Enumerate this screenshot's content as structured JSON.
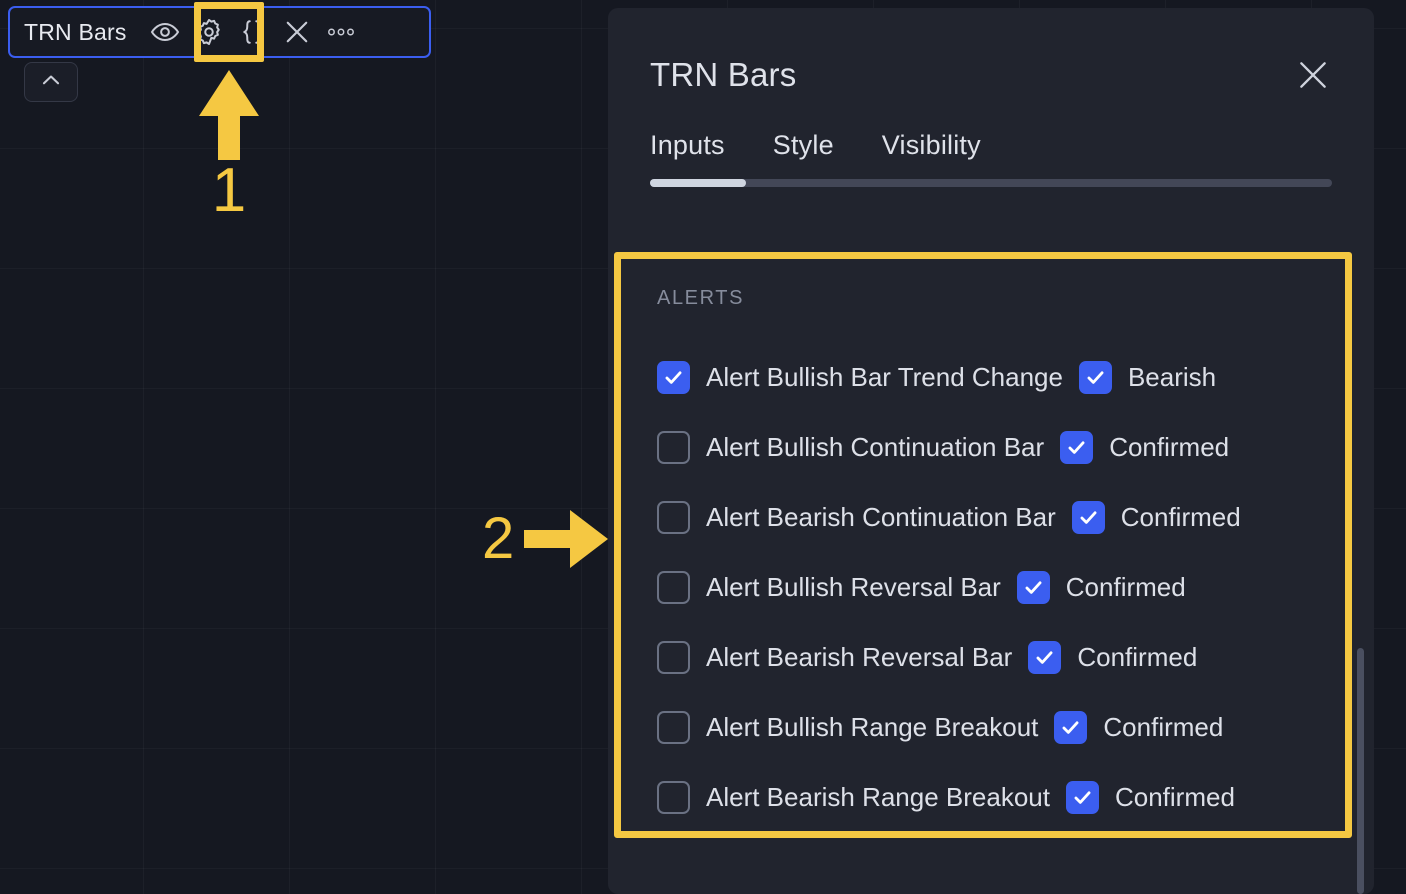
{
  "chart": {
    "background_color": "#151821",
    "grid": true
  },
  "indicator_toolbar": {
    "title": "TRN Bars",
    "border_color": "#3b5ef0",
    "icons": [
      {
        "name": "eye-icon",
        "label": "Hide / show indicator"
      },
      {
        "name": "gear-icon",
        "label": "Settings"
      },
      {
        "name": "braces-icon",
        "label": "Source code"
      },
      {
        "name": "close-icon",
        "label": "Remove indicator"
      },
      {
        "name": "more-icon",
        "label": "More"
      }
    ],
    "collapse_button": {
      "name": "chevron-up-icon",
      "label": "Collapse pane"
    }
  },
  "annotations": {
    "highlight_color": "#f5c842",
    "marker_one": {
      "number": "1",
      "direction": "up",
      "target": "gear-icon"
    },
    "marker_two": {
      "number": "2",
      "direction": "right",
      "target": "alerts-section"
    }
  },
  "dialog": {
    "title": "TRN Bars",
    "close_label": "×",
    "background_color": "#21242e",
    "tabs": [
      {
        "label": "Inputs",
        "active": true
      },
      {
        "label": "Style",
        "active": false
      },
      {
        "label": "Visibility",
        "active": false
      }
    ],
    "section": {
      "label": "ALERTS",
      "rows": [
        {
          "checked": true,
          "label": "Alert Bullish Bar Trend Change",
          "sub_checked": true,
          "sub_label": "Bearish"
        },
        {
          "checked": false,
          "label": "Alert Bullish Continuation Bar",
          "sub_checked": true,
          "sub_label": "Confirmed"
        },
        {
          "checked": false,
          "label": "Alert Bearish Continuation Bar",
          "sub_checked": true,
          "sub_label": "Confirmed"
        },
        {
          "checked": false,
          "label": "Alert Bullish Reversal Bar",
          "sub_checked": true,
          "sub_label": "Confirmed"
        },
        {
          "checked": false,
          "label": "Alert Bearish Reversal Bar",
          "sub_checked": true,
          "sub_label": "Confirmed"
        },
        {
          "checked": false,
          "label": "Alert Bullish Range Breakout",
          "sub_checked": true,
          "sub_label": "Confirmed"
        },
        {
          "checked": false,
          "label": "Alert Bearish Range Breakout",
          "sub_checked": true,
          "sub_label": "Confirmed"
        }
      ]
    },
    "accent_color": "#3b5ef0"
  }
}
